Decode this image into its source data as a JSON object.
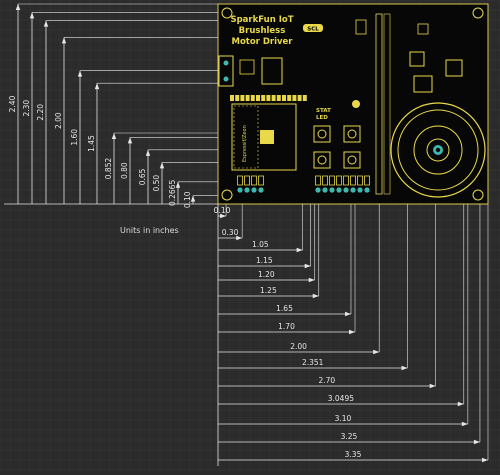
{
  "board": {
    "title_lines": [
      "SparkFun IoT",
      "Brushless",
      "Motor Driver"
    ],
    "badge": "SCL",
    "stat_label": "STAT",
    "stat_led": "LED",
    "module_label": "Espressif/Zeon"
  },
  "units_label": "Units in inches",
  "vertical_dims": [
    "2.40",
    "2.30",
    "2.20",
    "2.00",
    "1.60",
    "1.45",
    "0.852",
    "0.80",
    "0.65",
    "0.50",
    "0.2665",
    "0.10"
  ],
  "horizontal_dims": [
    "0.10",
    "0.30",
    "1.05",
    "1.15",
    "1.20",
    "1.25",
    "1.65",
    "1.70",
    "2.00",
    "2.351",
    "2.70",
    "3.0495",
    "3.10",
    "3.25",
    "3.35"
  ],
  "colors": {
    "background": "#2b2b2b",
    "grid": "#3a3a3a",
    "board": "#070707",
    "silkscreen": "#e8d84a",
    "pad_teal": "#3fb9b0",
    "dim_line": "#e6e6e6"
  }
}
